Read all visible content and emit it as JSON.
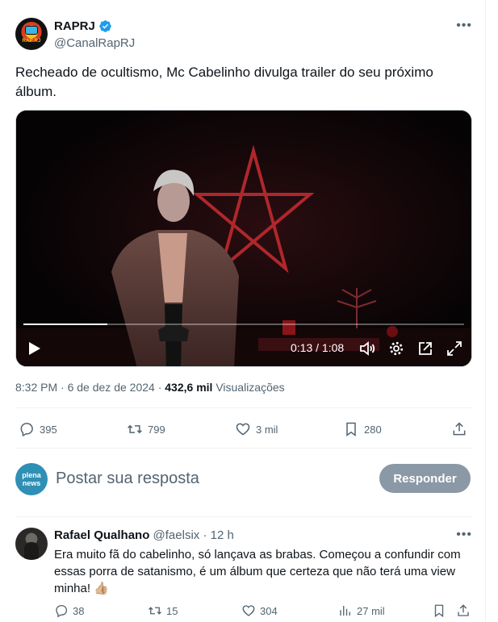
{
  "tweet": {
    "display_name": "RAPRJ",
    "handle": "@CanalRapRJ",
    "avatar_text": "RAP RJ",
    "text": "Recheado de ocultismo, Mc Cabelinho divulga trailer do seu próximo álbum.",
    "video": {
      "elapsed": "0:13",
      "duration": "1:08",
      "timecode": "0:13 / 1:08",
      "progress": 0.19
    },
    "meta": {
      "time": "8:32 PM",
      "date": "6 de dez de 2024",
      "views_count": "432,6 mil",
      "views_label": "Visualizações"
    },
    "stats": {
      "replies": "395",
      "reposts": "799",
      "likes": "3 mil",
      "bookmarks": "280"
    }
  },
  "compose": {
    "avatar_text_line1": "plena",
    "avatar_text_line2": "news",
    "placeholder": "Postar sua resposta",
    "button_label": "Responder"
  },
  "reply": {
    "display_name": "Rafael Qualhano",
    "handle": "@faelsix",
    "separator": "·",
    "age": "12 h",
    "text": "Era muito fã do cabelinho, só lançava as brabas. Começou a confundir com essas porra de satanismo, é um álbum que certeza que não terá uma view minha!",
    "emoji": "👍🏼",
    "stats": {
      "replies": "38",
      "reposts": "15",
      "likes": "304",
      "views": "27 mil"
    }
  },
  "colors": {
    "text": "#0f1419",
    "muted": "#536471",
    "verified": "#1d9bf0",
    "button": "#8b98a5",
    "pentagram": "#b0272b"
  },
  "icons": [
    "verified-badge-icon",
    "more-icon",
    "play-icon",
    "volume-icon",
    "gear-icon",
    "pip-icon",
    "fullscreen-icon",
    "reply-icon",
    "repost-icon",
    "like-icon",
    "bookmark-icon",
    "share-icon",
    "views-icon"
  ]
}
